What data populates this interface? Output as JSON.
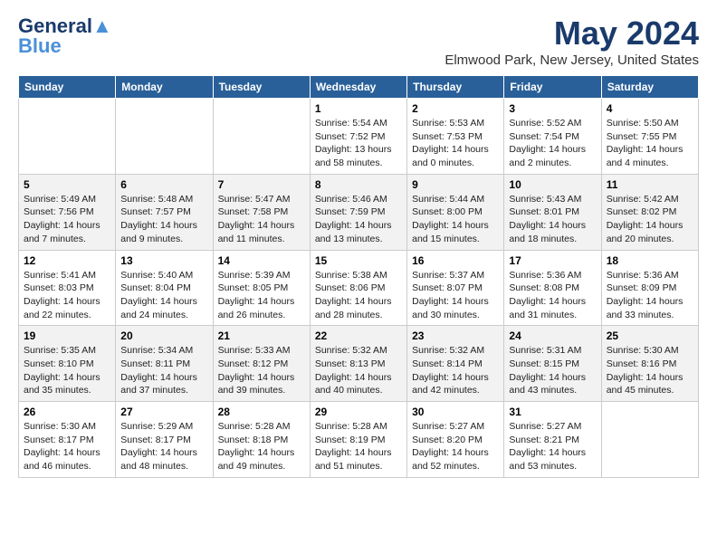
{
  "logo": {
    "line1": "General",
    "line2": "Blue"
  },
  "title": "May 2024",
  "location": "Elmwood Park, New Jersey, United States",
  "days_of_week": [
    "Sunday",
    "Monday",
    "Tuesday",
    "Wednesday",
    "Thursday",
    "Friday",
    "Saturday"
  ],
  "weeks": [
    [
      {
        "day": "",
        "info": ""
      },
      {
        "day": "",
        "info": ""
      },
      {
        "day": "",
        "info": ""
      },
      {
        "day": "1",
        "info": "Sunrise: 5:54 AM\nSunset: 7:52 PM\nDaylight: 13 hours\nand 58 minutes."
      },
      {
        "day": "2",
        "info": "Sunrise: 5:53 AM\nSunset: 7:53 PM\nDaylight: 14 hours\nand 0 minutes."
      },
      {
        "day": "3",
        "info": "Sunrise: 5:52 AM\nSunset: 7:54 PM\nDaylight: 14 hours\nand 2 minutes."
      },
      {
        "day": "4",
        "info": "Sunrise: 5:50 AM\nSunset: 7:55 PM\nDaylight: 14 hours\nand 4 minutes."
      }
    ],
    [
      {
        "day": "5",
        "info": "Sunrise: 5:49 AM\nSunset: 7:56 PM\nDaylight: 14 hours\nand 7 minutes."
      },
      {
        "day": "6",
        "info": "Sunrise: 5:48 AM\nSunset: 7:57 PM\nDaylight: 14 hours\nand 9 minutes."
      },
      {
        "day": "7",
        "info": "Sunrise: 5:47 AM\nSunset: 7:58 PM\nDaylight: 14 hours\nand 11 minutes."
      },
      {
        "day": "8",
        "info": "Sunrise: 5:46 AM\nSunset: 7:59 PM\nDaylight: 14 hours\nand 13 minutes."
      },
      {
        "day": "9",
        "info": "Sunrise: 5:44 AM\nSunset: 8:00 PM\nDaylight: 14 hours\nand 15 minutes."
      },
      {
        "day": "10",
        "info": "Sunrise: 5:43 AM\nSunset: 8:01 PM\nDaylight: 14 hours\nand 18 minutes."
      },
      {
        "day": "11",
        "info": "Sunrise: 5:42 AM\nSunset: 8:02 PM\nDaylight: 14 hours\nand 20 minutes."
      }
    ],
    [
      {
        "day": "12",
        "info": "Sunrise: 5:41 AM\nSunset: 8:03 PM\nDaylight: 14 hours\nand 22 minutes."
      },
      {
        "day": "13",
        "info": "Sunrise: 5:40 AM\nSunset: 8:04 PM\nDaylight: 14 hours\nand 24 minutes."
      },
      {
        "day": "14",
        "info": "Sunrise: 5:39 AM\nSunset: 8:05 PM\nDaylight: 14 hours\nand 26 minutes."
      },
      {
        "day": "15",
        "info": "Sunrise: 5:38 AM\nSunset: 8:06 PM\nDaylight: 14 hours\nand 28 minutes."
      },
      {
        "day": "16",
        "info": "Sunrise: 5:37 AM\nSunset: 8:07 PM\nDaylight: 14 hours\nand 30 minutes."
      },
      {
        "day": "17",
        "info": "Sunrise: 5:36 AM\nSunset: 8:08 PM\nDaylight: 14 hours\nand 31 minutes."
      },
      {
        "day": "18",
        "info": "Sunrise: 5:36 AM\nSunset: 8:09 PM\nDaylight: 14 hours\nand 33 minutes."
      }
    ],
    [
      {
        "day": "19",
        "info": "Sunrise: 5:35 AM\nSunset: 8:10 PM\nDaylight: 14 hours\nand 35 minutes."
      },
      {
        "day": "20",
        "info": "Sunrise: 5:34 AM\nSunset: 8:11 PM\nDaylight: 14 hours\nand 37 minutes."
      },
      {
        "day": "21",
        "info": "Sunrise: 5:33 AM\nSunset: 8:12 PM\nDaylight: 14 hours\nand 39 minutes."
      },
      {
        "day": "22",
        "info": "Sunrise: 5:32 AM\nSunset: 8:13 PM\nDaylight: 14 hours\nand 40 minutes."
      },
      {
        "day": "23",
        "info": "Sunrise: 5:32 AM\nSunset: 8:14 PM\nDaylight: 14 hours\nand 42 minutes."
      },
      {
        "day": "24",
        "info": "Sunrise: 5:31 AM\nSunset: 8:15 PM\nDaylight: 14 hours\nand 43 minutes."
      },
      {
        "day": "25",
        "info": "Sunrise: 5:30 AM\nSunset: 8:16 PM\nDaylight: 14 hours\nand 45 minutes."
      }
    ],
    [
      {
        "day": "26",
        "info": "Sunrise: 5:30 AM\nSunset: 8:17 PM\nDaylight: 14 hours\nand 46 minutes."
      },
      {
        "day": "27",
        "info": "Sunrise: 5:29 AM\nSunset: 8:17 PM\nDaylight: 14 hours\nand 48 minutes."
      },
      {
        "day": "28",
        "info": "Sunrise: 5:28 AM\nSunset: 8:18 PM\nDaylight: 14 hours\nand 49 minutes."
      },
      {
        "day": "29",
        "info": "Sunrise: 5:28 AM\nSunset: 8:19 PM\nDaylight: 14 hours\nand 51 minutes."
      },
      {
        "day": "30",
        "info": "Sunrise: 5:27 AM\nSunset: 8:20 PM\nDaylight: 14 hours\nand 52 minutes."
      },
      {
        "day": "31",
        "info": "Sunrise: 5:27 AM\nSunset: 8:21 PM\nDaylight: 14 hours\nand 53 minutes."
      },
      {
        "day": "",
        "info": ""
      }
    ]
  ]
}
